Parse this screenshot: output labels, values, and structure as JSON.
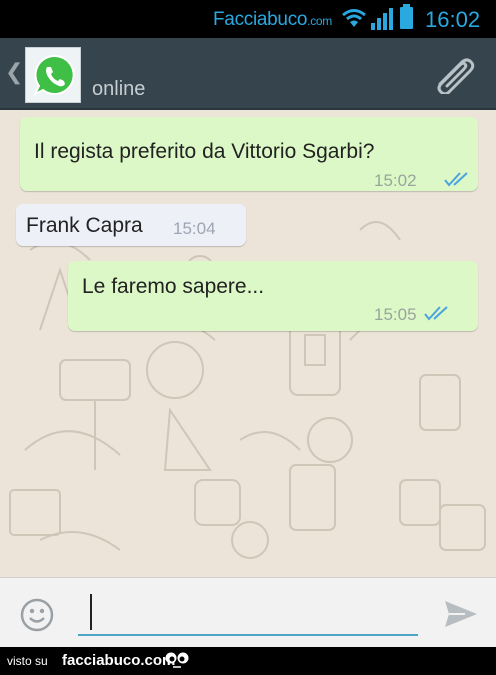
{
  "status_bar": {
    "brand": "Facciabuco",
    "brand_domain": ".com",
    "time": "16:02",
    "icons": [
      "wifi-icon",
      "signal-icon",
      "battery-icon"
    ],
    "accent_color": "#2aa8e0"
  },
  "header": {
    "contact_status": "online",
    "avatar_icon": "whatsapp-logo-icon",
    "back_icon": "chevron-left-icon",
    "attach_icon": "paperclip-icon",
    "background_color": "#35444d"
  },
  "messages": [
    {
      "direction": "outgoing",
      "text": "Il regista preferito da Vittorio Sgarbi?",
      "time": "15:02",
      "status_icon": "double-check-icon"
    },
    {
      "direction": "incoming",
      "text": "Frank Capra",
      "time": "15:04"
    },
    {
      "direction": "outgoing",
      "text": "Le faremo sapere...",
      "time": "15:05",
      "status_icon": "double-check-icon"
    }
  ],
  "composer": {
    "value": "",
    "emoji_icon": "smiley-icon",
    "send_icon": "send-icon"
  },
  "footer": {
    "prefix": "visto su",
    "brand": "facciabuco.com",
    "logo_icon": "eyes-logo-icon"
  },
  "colors": {
    "outgoing_bubble": "#dcf8c7",
    "incoming_bubble": "#eef0f8",
    "chat_background": "#ece4d9",
    "read_ticks": "#4aa3df"
  }
}
